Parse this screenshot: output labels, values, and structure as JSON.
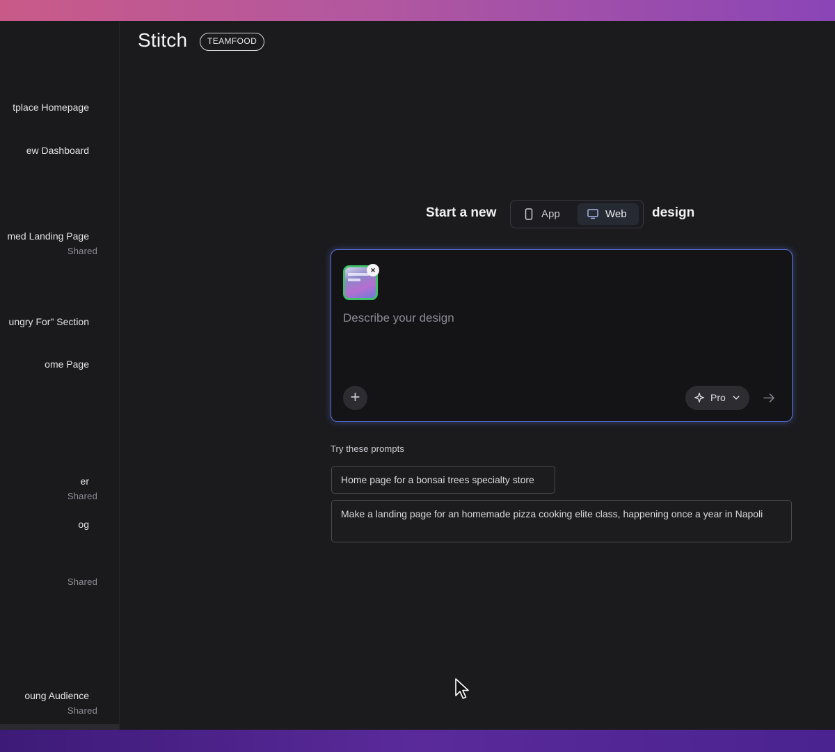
{
  "app": {
    "title": "Stitch",
    "badge": "TEAMFOOD"
  },
  "sidebar": {
    "items": [
      {
        "label": "tplace Homepage",
        "badge": ""
      },
      {
        "label": "ew Dashboard",
        "badge": ""
      },
      {
        "label": "med Landing Page",
        "badge": "Shared"
      },
      {
        "label": "ungry For\" Section",
        "badge": ""
      },
      {
        "label": "ome Page",
        "badge": ""
      },
      {
        "label": "er",
        "badge": "Shared"
      },
      {
        "label": "og",
        "badge": ""
      },
      {
        "label": "",
        "badge": "Shared"
      },
      {
        "label": "oung Audience",
        "badge": "Shared"
      }
    ]
  },
  "start": {
    "prefix": "Start a new",
    "suffix": "design",
    "options": [
      {
        "label": "App",
        "icon": "phone-icon",
        "active": false
      },
      {
        "label": "Web",
        "icon": "monitor-icon",
        "active": true
      }
    ]
  },
  "composer": {
    "placeholder": "Describe your design",
    "model_label": "Pro",
    "add_icon": "plus-icon",
    "send_icon": "arrow-right-icon"
  },
  "prompts": {
    "label": "Try these prompts",
    "items": [
      "Home page for a bonsai trees specialty store",
      "Make a landing page for an homemade pizza cooking elite class, happening once a year in Napoli"
    ]
  },
  "colors": {
    "accent_border": "#5b71d8",
    "thumb_border": "#3fc26a",
    "background": "#1b1b1e"
  }
}
